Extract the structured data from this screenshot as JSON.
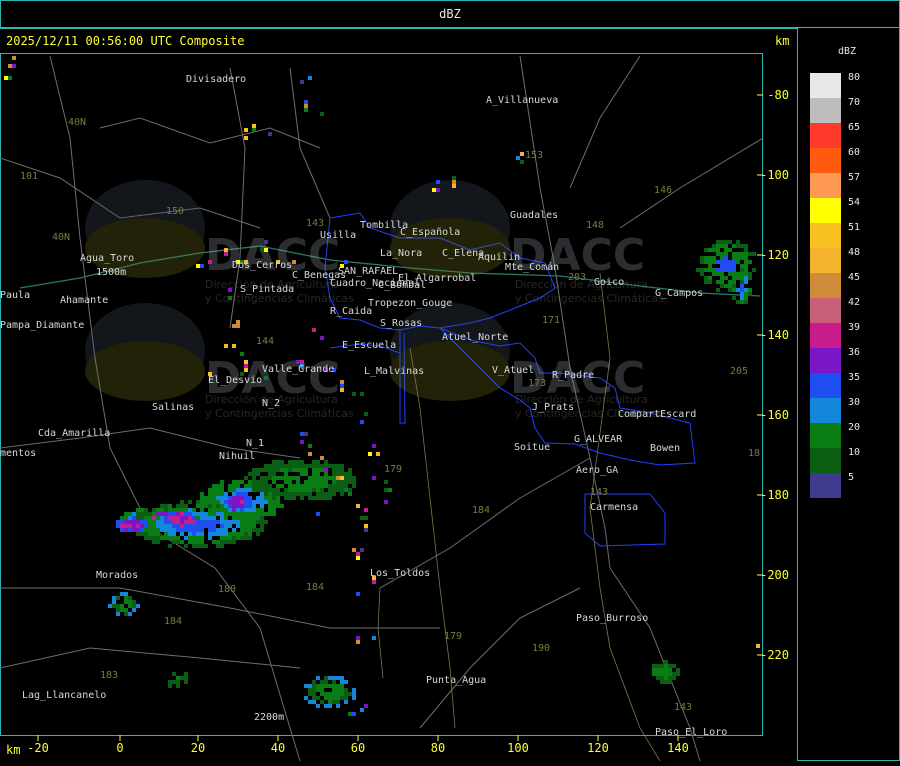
{
  "header": {
    "product": "dBZ"
  },
  "map": {
    "timestamp": "2025/12/11 00:56:00 UTC Composite",
    "unit_right": "km",
    "unit_bottom": "km",
    "x_ticks": [
      "-20",
      "0",
      "20",
      "40",
      "60",
      "80",
      "100",
      "120",
      "140"
    ],
    "y_ticks": [
      "-80",
      "-100",
      "-120",
      "-140",
      "-160",
      "-180",
      "-200",
      "-220"
    ],
    "watermark": {
      "logo": "DACC",
      "line1": "Dirección de Agricultura",
      "line2": "y Contingencias Climáticas"
    },
    "places": [
      "Divisadero",
      "A_Villanueva",
      "Agua_Toro",
      "1500m",
      "Pampa_Diamante",
      "Cda_Amarilla",
      "Salinas",
      "Nihuil",
      "El_Desvio",
      "S_Pintada",
      "C_Benegas",
      "SAN_RAFAEL",
      "Cuadro_Nacional",
      "Usilla",
      "Tombilla",
      "La_Nora",
      "C_Española",
      "C_Elena",
      "Guadales",
      "Aquilin",
      "Mte_Comán",
      "C_Bombal",
      "El_Algarrobal",
      "Tropezon_Gouge",
      "R_Caida",
      "S_Rosas",
      "E_Escuela",
      "Atuel_Norte",
      "Valle_Grande",
      "L_Malvinas",
      "V_Atuel",
      "R_Padre",
      "J_Prats",
      "CompartEscard",
      "G_ALVEAR",
      "Soitue",
      "Bowen",
      "Aero_GA",
      "Carmensa",
      "Los_Toldos",
      "Morados",
      "Punta_Agua",
      "Paso_Burroso",
      "Lag_Llancanelo",
      "2200m",
      "Paso_El_Loro",
      "Goico",
      "G_Campos",
      "Dos_Cerros",
      "N_2",
      "N_1",
      "mentos",
      "Paula",
      "Ahamante"
    ],
    "routes": [
      "40N",
      "40N",
      "101",
      "153",
      "146",
      "148",
      "150",
      "143",
      "203",
      "171",
      "173",
      "179",
      "184",
      "180",
      "184",
      "184",
      "183",
      "179",
      "190",
      "143",
      "143",
      "144",
      "205",
      "18"
    ]
  },
  "legend": {
    "title": "dBZ",
    "levels": [
      {
        "label": "80",
        "color": "#e8e8e8"
      },
      {
        "label": "70",
        "color": "#bdbdbd"
      },
      {
        "label": "65",
        "color": "#ff3a2a"
      },
      {
        "label": "60",
        "color": "#ff5a10"
      },
      {
        "label": "57",
        "color": "#ff9a55"
      },
      {
        "label": "54",
        "color": "#ffff00"
      },
      {
        "label": "51",
        "color": "#f7c21f"
      },
      {
        "label": "48",
        "color": "#f5b42e"
      },
      {
        "label": "45",
        "color": "#cf8a3a"
      },
      {
        "label": "42",
        "color": "#c8607a"
      },
      {
        "label": "39",
        "color": "#c81c8e"
      },
      {
        "label": "36",
        "color": "#7b16c8"
      },
      {
        "label": "35",
        "color": "#1e4ef0"
      },
      {
        "label": "30",
        "color": "#1486dc"
      },
      {
        "label": "20",
        "color": "#0a7d14"
      },
      {
        "label": "10",
        "color": "#0a5f14"
      },
      {
        "label": "5",
        "color": "#3f3a8c"
      }
    ]
  }
}
